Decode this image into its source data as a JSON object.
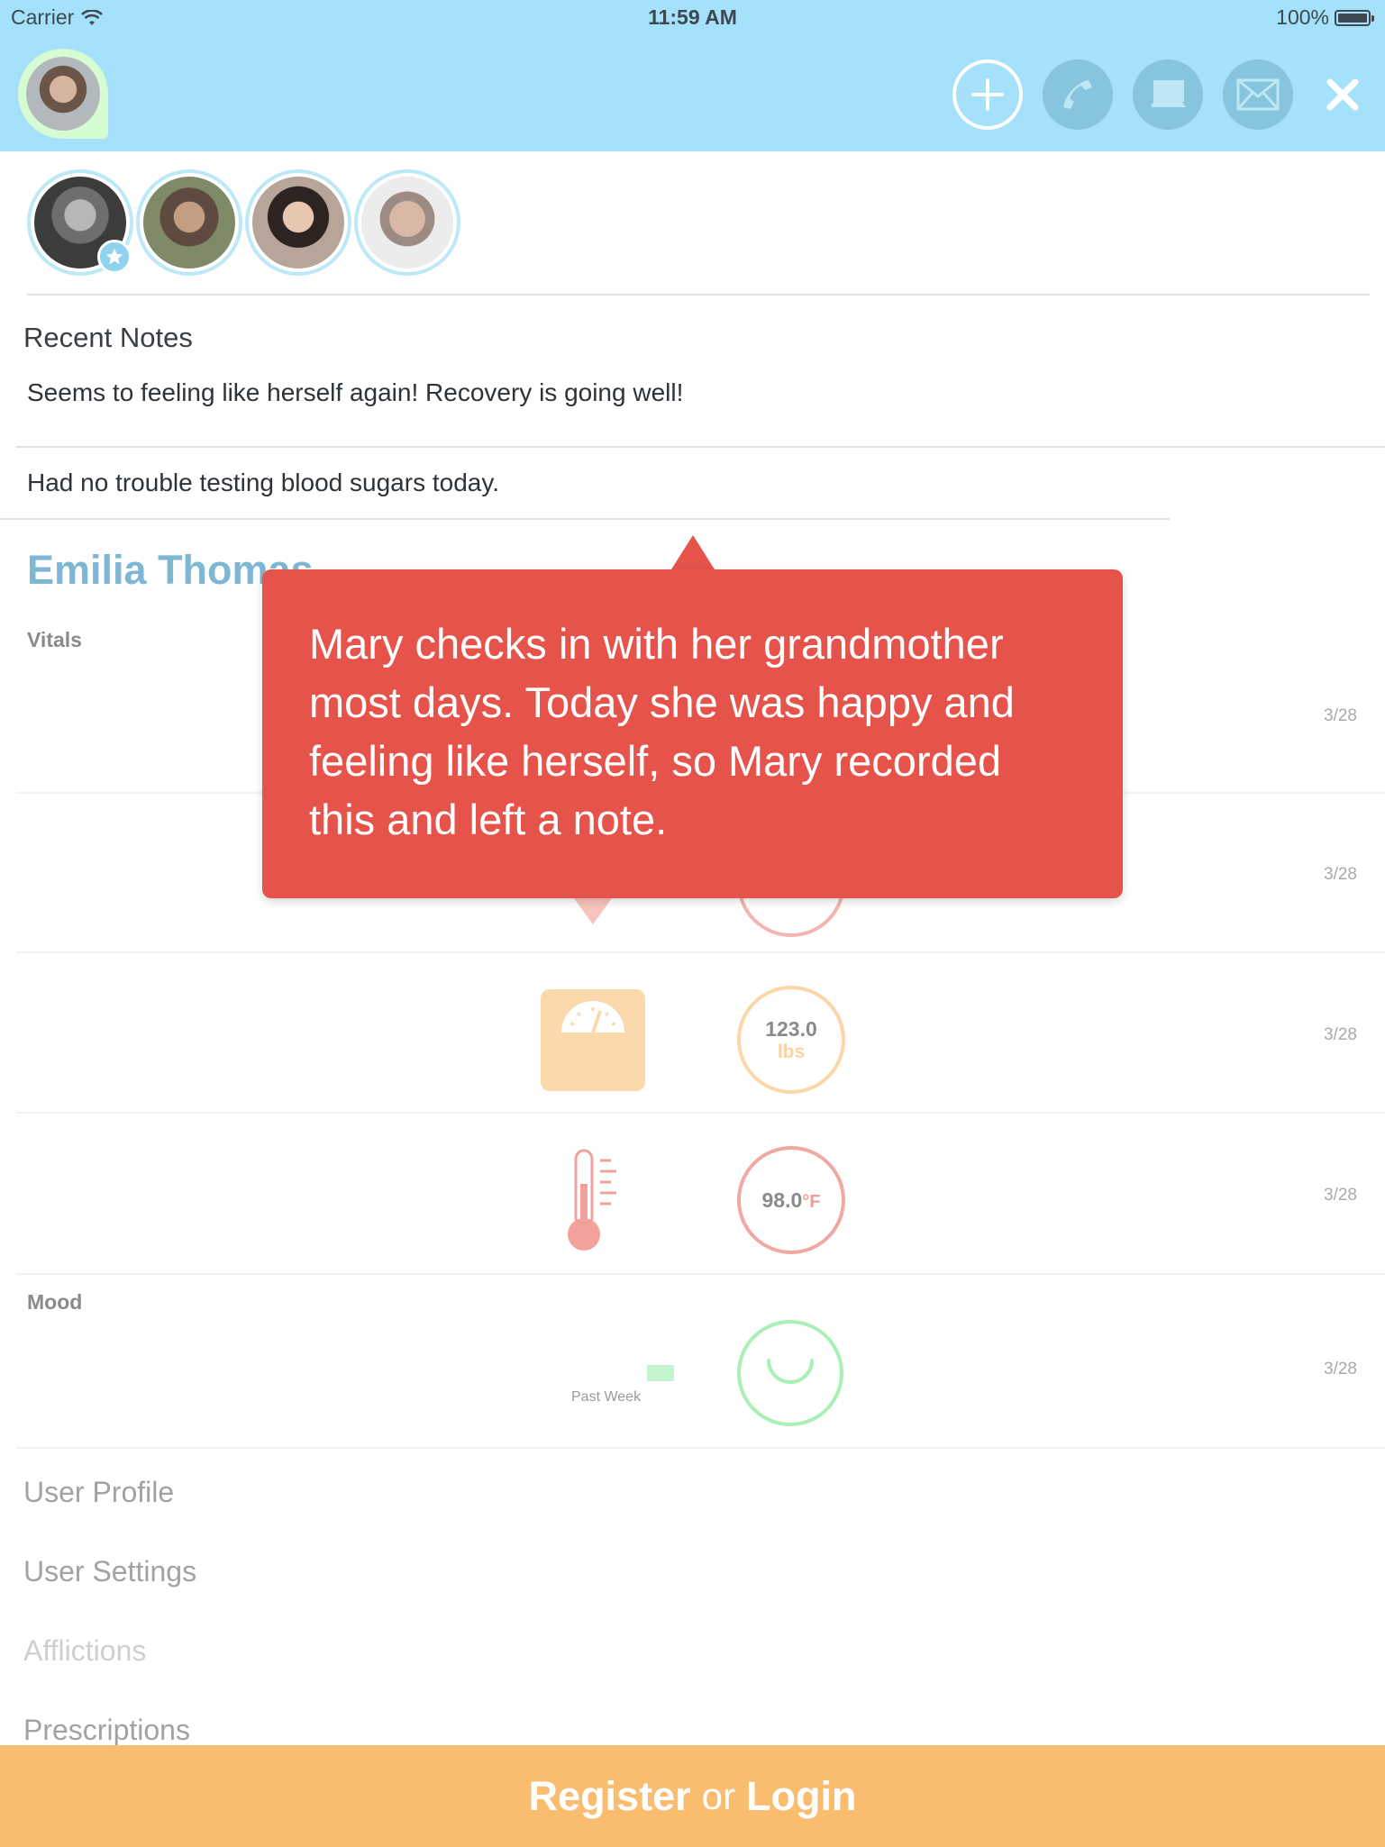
{
  "status_bar": {
    "carrier": "Carrier",
    "time": "11:59 AM",
    "battery": "100%"
  },
  "header": {
    "icons": {
      "add": "plus-circle-icon",
      "call": "phone-icon",
      "video": "video-chat-icon",
      "mail": "envelope-icon",
      "close": "close-icon"
    },
    "colors": {
      "background": "#a5e1fa",
      "button": "#86c5dd"
    }
  },
  "recent_notes": {
    "title": "Recent Notes",
    "items": [
      "Seems to feeling like herself again! Recovery is going well!",
      "Had no trouble testing blood sugars today."
    ]
  },
  "patient": {
    "name": "Emilia Thomas"
  },
  "sections": {
    "vitals": "Vitals",
    "mood": "Mood"
  },
  "vitals": [
    {
      "date": "3/28"
    },
    {
      "date": "3/28"
    },
    {
      "value": "123.0",
      "unit": "lbs",
      "date": "3/28"
    },
    {
      "value": "98.0",
      "unit": "°F",
      "date": "3/28"
    }
  ],
  "mood": {
    "caption": "Past Week",
    "date": "3/28"
  },
  "menu": [
    "User Profile",
    "User Settings",
    "Afflictions",
    "Prescriptions"
  ],
  "tooltip": {
    "text": "Mary checks in with her grandmother most days. Today she was happy and feeling like herself, so Mary recorded this and left a note.",
    "color": "#e5534b"
  },
  "footer": {
    "register": "Register",
    "or": "or",
    "login": "Login",
    "color": "#fabd70"
  }
}
